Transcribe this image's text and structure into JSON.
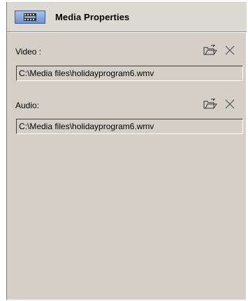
{
  "panel": {
    "title": "Media Properties",
    "icon": "film-strip-icon"
  },
  "video": {
    "label": "Video :",
    "path": "C:\\Media files\\holidayprogram6.wmv",
    "browse_icon": "open-folder-icon",
    "remove_icon": "close-icon"
  },
  "audio": {
    "label": "Audio:",
    "path": "C:\\Media files\\holidayprogram6.wmv",
    "browse_icon": "open-folder-icon",
    "remove_icon": "close-icon"
  }
}
